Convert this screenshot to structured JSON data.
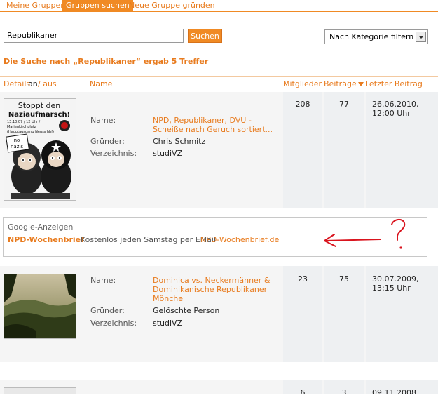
{
  "tabs": [
    {
      "label": "Meine Gruppen"
    },
    {
      "label": "Gruppen suchen"
    },
    {
      "label": "Neue Gruppe gründen"
    }
  ],
  "search": {
    "value": "Republikaner",
    "button": "Suchen"
  },
  "filter": {
    "selected": "Nach Kategorie filtern"
  },
  "result_text": "Die Suche nach „Republikaner“ ergab 5 Treffer",
  "header": {
    "details": "Details",
    "an": "an",
    "aus": "/ aus",
    "name": "Name",
    "members": "Mitglieder",
    "posts": "Beiträge",
    "last_post": "Letzter Beitrag"
  },
  "field_labels": {
    "name": "Name:",
    "founder": "Gründer:",
    "directory": "Verzeichnis:"
  },
  "groups": [
    {
      "name": "NPD, Republikaner, DVU - Scheiße nach Geruch sortiert...",
      "founder": "Chris Schmitz",
      "directory": "studiVZ",
      "members": "208",
      "posts": "77",
      "last_post_date": "26.06.2010,",
      "last_post_time": "12:00 Uhr",
      "thumb": {
        "line1": "Stoppt den",
        "line2": "Naziaufmarsch!",
        "line3": "13.10.07 / 12 Uhr /",
        "line4": "Marienkirchplatz",
        "line5": "(Hauptausgang Neuss hbf)",
        "sign1": "no",
        "sign2": "nazis"
      }
    },
    {
      "name": "Dominica vs. Neckermänner & Dominikanische Republikaner Mönche",
      "founder": "Gelöschte Person",
      "directory": "studiVZ",
      "members": "23",
      "posts": "75",
      "last_post_date": "30.07.2009,",
      "last_post_time": "13:15 Uhr"
    },
    {
      "members": "6",
      "posts": "3",
      "last_post_date": "09.11.2008"
    }
  ],
  "ad": {
    "label": "Google-Anzeigen",
    "title": "NPD-Wochenbrief",
    "text": "Kostenlos jeden Samstag per EMail",
    "link": "NPD-Wochenbrief.de"
  },
  "colors": {
    "accent": "#f08a24",
    "link": "#e87b1e",
    "annotation": "#d9141e"
  }
}
